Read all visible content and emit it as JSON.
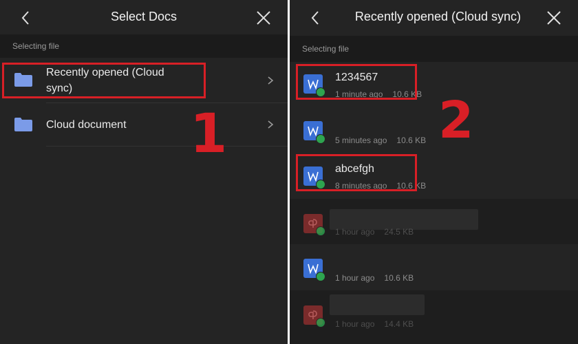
{
  "left_panel": {
    "title": "Select Docs",
    "section": "Selecting file",
    "items": [
      {
        "label": "Recently opened (Cloud sync)",
        "icon": "folder-icon"
      },
      {
        "label": "Cloud document",
        "icon": "folder-icon"
      }
    ]
  },
  "right_panel": {
    "title": "Recently opened (Cloud sync)",
    "section": "Selecting file",
    "files": [
      {
        "name": "1234567",
        "time": "1 minute ago",
        "size": "10.6 KB",
        "type": "word"
      },
      {
        "name": "",
        "time": "5 minutes ago",
        "size": "10.6 KB",
        "type": "word"
      },
      {
        "name": "abcefgh",
        "time": "8 minutes ago",
        "size": "10.6 KB",
        "type": "word"
      },
      {
        "name": "",
        "time": "1 hour ago",
        "size": "24.5 KB",
        "type": "pdf"
      },
      {
        "name": "",
        "time": "1 hour ago",
        "size": "10.6 KB",
        "type": "word"
      },
      {
        "name": "",
        "time": "1 hour ago",
        "size": "14.4 KB",
        "type": "pdf"
      }
    ]
  },
  "annotations": {
    "step1": "1",
    "step2": "2",
    "color": "#d81f26"
  },
  "colors": {
    "background": "#242424",
    "section": "#1b1b1b",
    "folder": "#7b9be8",
    "word": "#3a6fd4",
    "check": "#2ea44f"
  }
}
